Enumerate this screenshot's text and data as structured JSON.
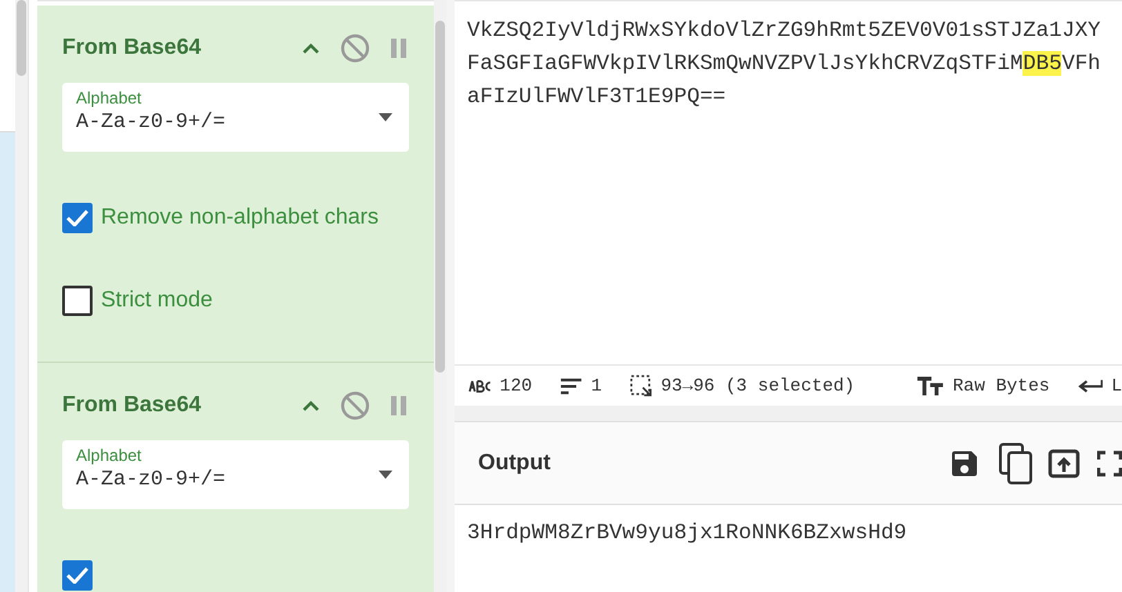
{
  "recipe": {
    "operations": [
      {
        "title": "From Base64",
        "alphabet": {
          "label": "Alphabet",
          "value": "A-Za-z0-9+/="
        },
        "options": [
          {
            "label": "Remove non-alphabet chars",
            "checked": true
          },
          {
            "label": "Strict mode",
            "checked": false
          }
        ]
      },
      {
        "title": "From Base64",
        "alphabet": {
          "label": "Alphabet",
          "value": "A-Za-z0-9+/="
        },
        "options": [
          {
            "checked": true
          }
        ]
      }
    ]
  },
  "input": {
    "lines": [
      [
        {
          "text": "VkZSQ2IyVldjRWxSYkdoVlZrZG9hRmt5ZEV0V01sSTJZa1JXY",
          "highlighted": false
        }
      ],
      [
        {
          "text": "FaSGFIaGFWVkpIVlRKSmQwNVZPVlJsYkhCRVZqSTFiM",
          "highlighted": false
        },
        {
          "text": "DB5",
          "highlighted": true
        },
        {
          "text": "VFh",
          "highlighted": false
        }
      ],
      [
        {
          "text": "aFIzUlFWVlF3T1E9PQ==",
          "highlighted": false
        }
      ]
    ]
  },
  "status_bar": {
    "length": "120",
    "lines": "1",
    "selection": "93→96 (3 selected)",
    "encoding": "Raw Bytes",
    "eol": "L"
  },
  "output": {
    "title": "Output",
    "text": "3HrdpWM8ZrBVw9yu8jx1RoNNK6BZxwsHd9"
  }
}
